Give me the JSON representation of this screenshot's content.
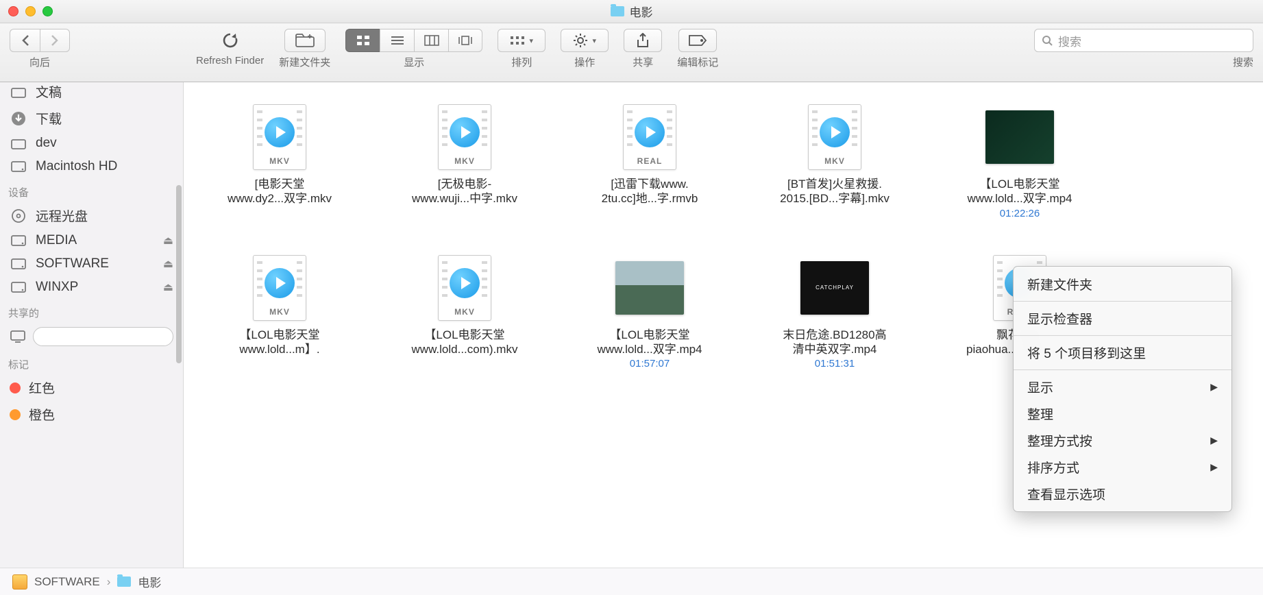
{
  "window": {
    "title": "电影"
  },
  "toolbar": {
    "back_label": "向后",
    "refresh_label": "Refresh Finder",
    "newfolder_label": "新建文件夹",
    "view_label": "显示",
    "arrange_label": "排列",
    "action_label": "操作",
    "share_label": "共享",
    "tags_label": "编辑标记",
    "search_label": "搜索",
    "search_placeholder": "搜索"
  },
  "sidebar": {
    "items": [
      {
        "label": "文稿",
        "icon": "folder"
      },
      {
        "label": "下载",
        "icon": "download"
      },
      {
        "label": "dev",
        "icon": "folder"
      },
      {
        "label": "Macintosh HD",
        "icon": "hdd"
      }
    ],
    "devices_header": "设备",
    "devices": [
      {
        "label": "远程光盘",
        "icon": "disc",
        "eject": false
      },
      {
        "label": "MEDIA",
        "icon": "hdd",
        "eject": true
      },
      {
        "label": "SOFTWARE",
        "icon": "hdd",
        "eject": true
      },
      {
        "label": "WINXP",
        "icon": "hdd",
        "eject": true
      }
    ],
    "shared_header": "共享的",
    "tags_header": "标记",
    "tags": [
      {
        "label": "红色",
        "color": "#ff5b4c"
      },
      {
        "label": "橙色",
        "color": "#ff9a2e"
      }
    ]
  },
  "files": [
    {
      "line1": "[电影天堂",
      "line2": "www.dy2...双字.mkv",
      "type": "MKV",
      "thumb": "doc",
      "time": ""
    },
    {
      "line1": "[无极电影-",
      "line2": "www.wuji...中字.mkv",
      "type": "MKV",
      "thumb": "doc",
      "time": ""
    },
    {
      "line1": "[迅雷下载www.",
      "line2": "2tu.cc]地...字.rmvb",
      "type": "REAL",
      "thumb": "doc",
      "time": ""
    },
    {
      "line1": "[BT首发]火星救援.",
      "line2": "2015.[BD...字幕].mkv",
      "type": "MKV",
      "thumb": "doc",
      "time": ""
    },
    {
      "line1": "【LOL电影天堂",
      "line2": "www.lold...双字.mp4",
      "type": "",
      "thumb": "video-dark",
      "time": "01:22:26"
    },
    {
      "line1": "【LOL电影天堂",
      "line2": "www.lold...m】.",
      "type": "MKV",
      "thumb": "doc",
      "time": ""
    },
    {
      "line1": "【LOL电影天堂",
      "line2": "www.lold...com).mkv",
      "type": "MKV",
      "thumb": "doc",
      "time": ""
    },
    {
      "line1": "【LOL电影天堂",
      "line2": "www.lold...双字.mp4",
      "type": "",
      "thumb": "video-city",
      "time": "01:57:07"
    },
    {
      "line1": "末日危途.BD1280高",
      "line2": "清中英双字.mp4",
      "type": "",
      "thumb": "video-black",
      "time": "01:51:31"
    },
    {
      "line1": "飘花电影",
      "line2": "piaohua....高清.rmvb",
      "type": "REAL",
      "thumb": "doc",
      "time": ""
    }
  ],
  "context_menu": {
    "items": [
      {
        "label": "新建文件夹",
        "sub": false
      },
      null,
      {
        "label": "显示检查器",
        "sub": false
      },
      null,
      {
        "label": "将 5 个项目移到这里",
        "sub": false
      },
      null,
      {
        "label": "显示",
        "sub": true
      },
      {
        "label": "整理",
        "sub": false
      },
      {
        "label": "整理方式按",
        "sub": true
      },
      {
        "label": "排序方式",
        "sub": true
      },
      {
        "label": "查看显示选项",
        "sub": false
      }
    ]
  },
  "pathbar": {
    "drive": "SOFTWARE",
    "folder": "电影",
    "sep": "›"
  }
}
